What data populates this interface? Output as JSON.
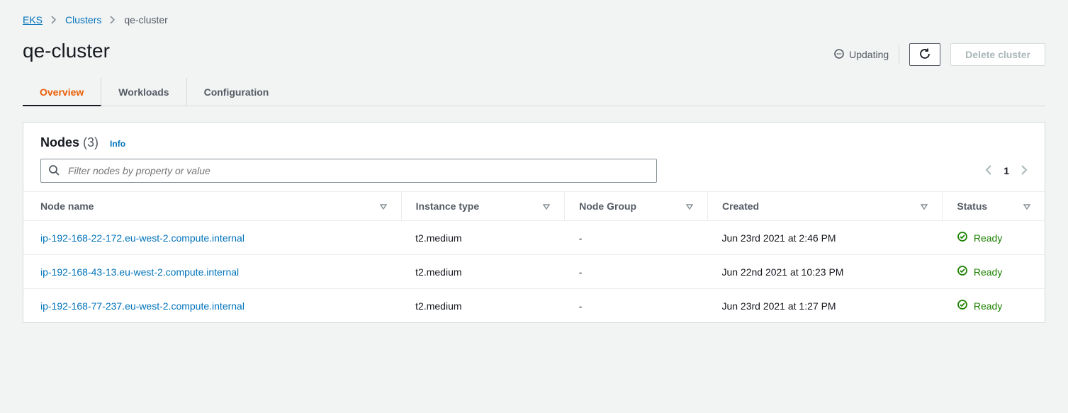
{
  "breadcrumb": {
    "root": "EKS",
    "parent": "Clusters",
    "current": "qe-cluster"
  },
  "page_title": "qe-cluster",
  "header": {
    "status_label": "Updating",
    "delete_label": "Delete cluster"
  },
  "tabs": [
    {
      "label": "Overview"
    },
    {
      "label": "Workloads"
    },
    {
      "label": "Configuration"
    }
  ],
  "nodes_panel": {
    "title": "Nodes",
    "count": "(3)",
    "info_label": "Info",
    "filter_placeholder": "Filter nodes by property or value",
    "page_number": "1"
  },
  "columns": {
    "name": "Node name",
    "instance": "Instance type",
    "group": "Node Group",
    "created": "Created",
    "status": "Status"
  },
  "rows": [
    {
      "name": "ip-192-168-22-172.eu-west-2.compute.internal",
      "instance": "t2.medium",
      "group": "-",
      "created": "Jun 23rd 2021 at 2:46 PM",
      "status": "Ready"
    },
    {
      "name": "ip-192-168-43-13.eu-west-2.compute.internal",
      "instance": "t2.medium",
      "group": "-",
      "created": "Jun 22nd 2021 at 10:23 PM",
      "status": "Ready"
    },
    {
      "name": "ip-192-168-77-237.eu-west-2.compute.internal",
      "instance": "t2.medium",
      "group": "-",
      "created": "Jun 23rd 2021 at 1:27 PM",
      "status": "Ready"
    }
  ]
}
